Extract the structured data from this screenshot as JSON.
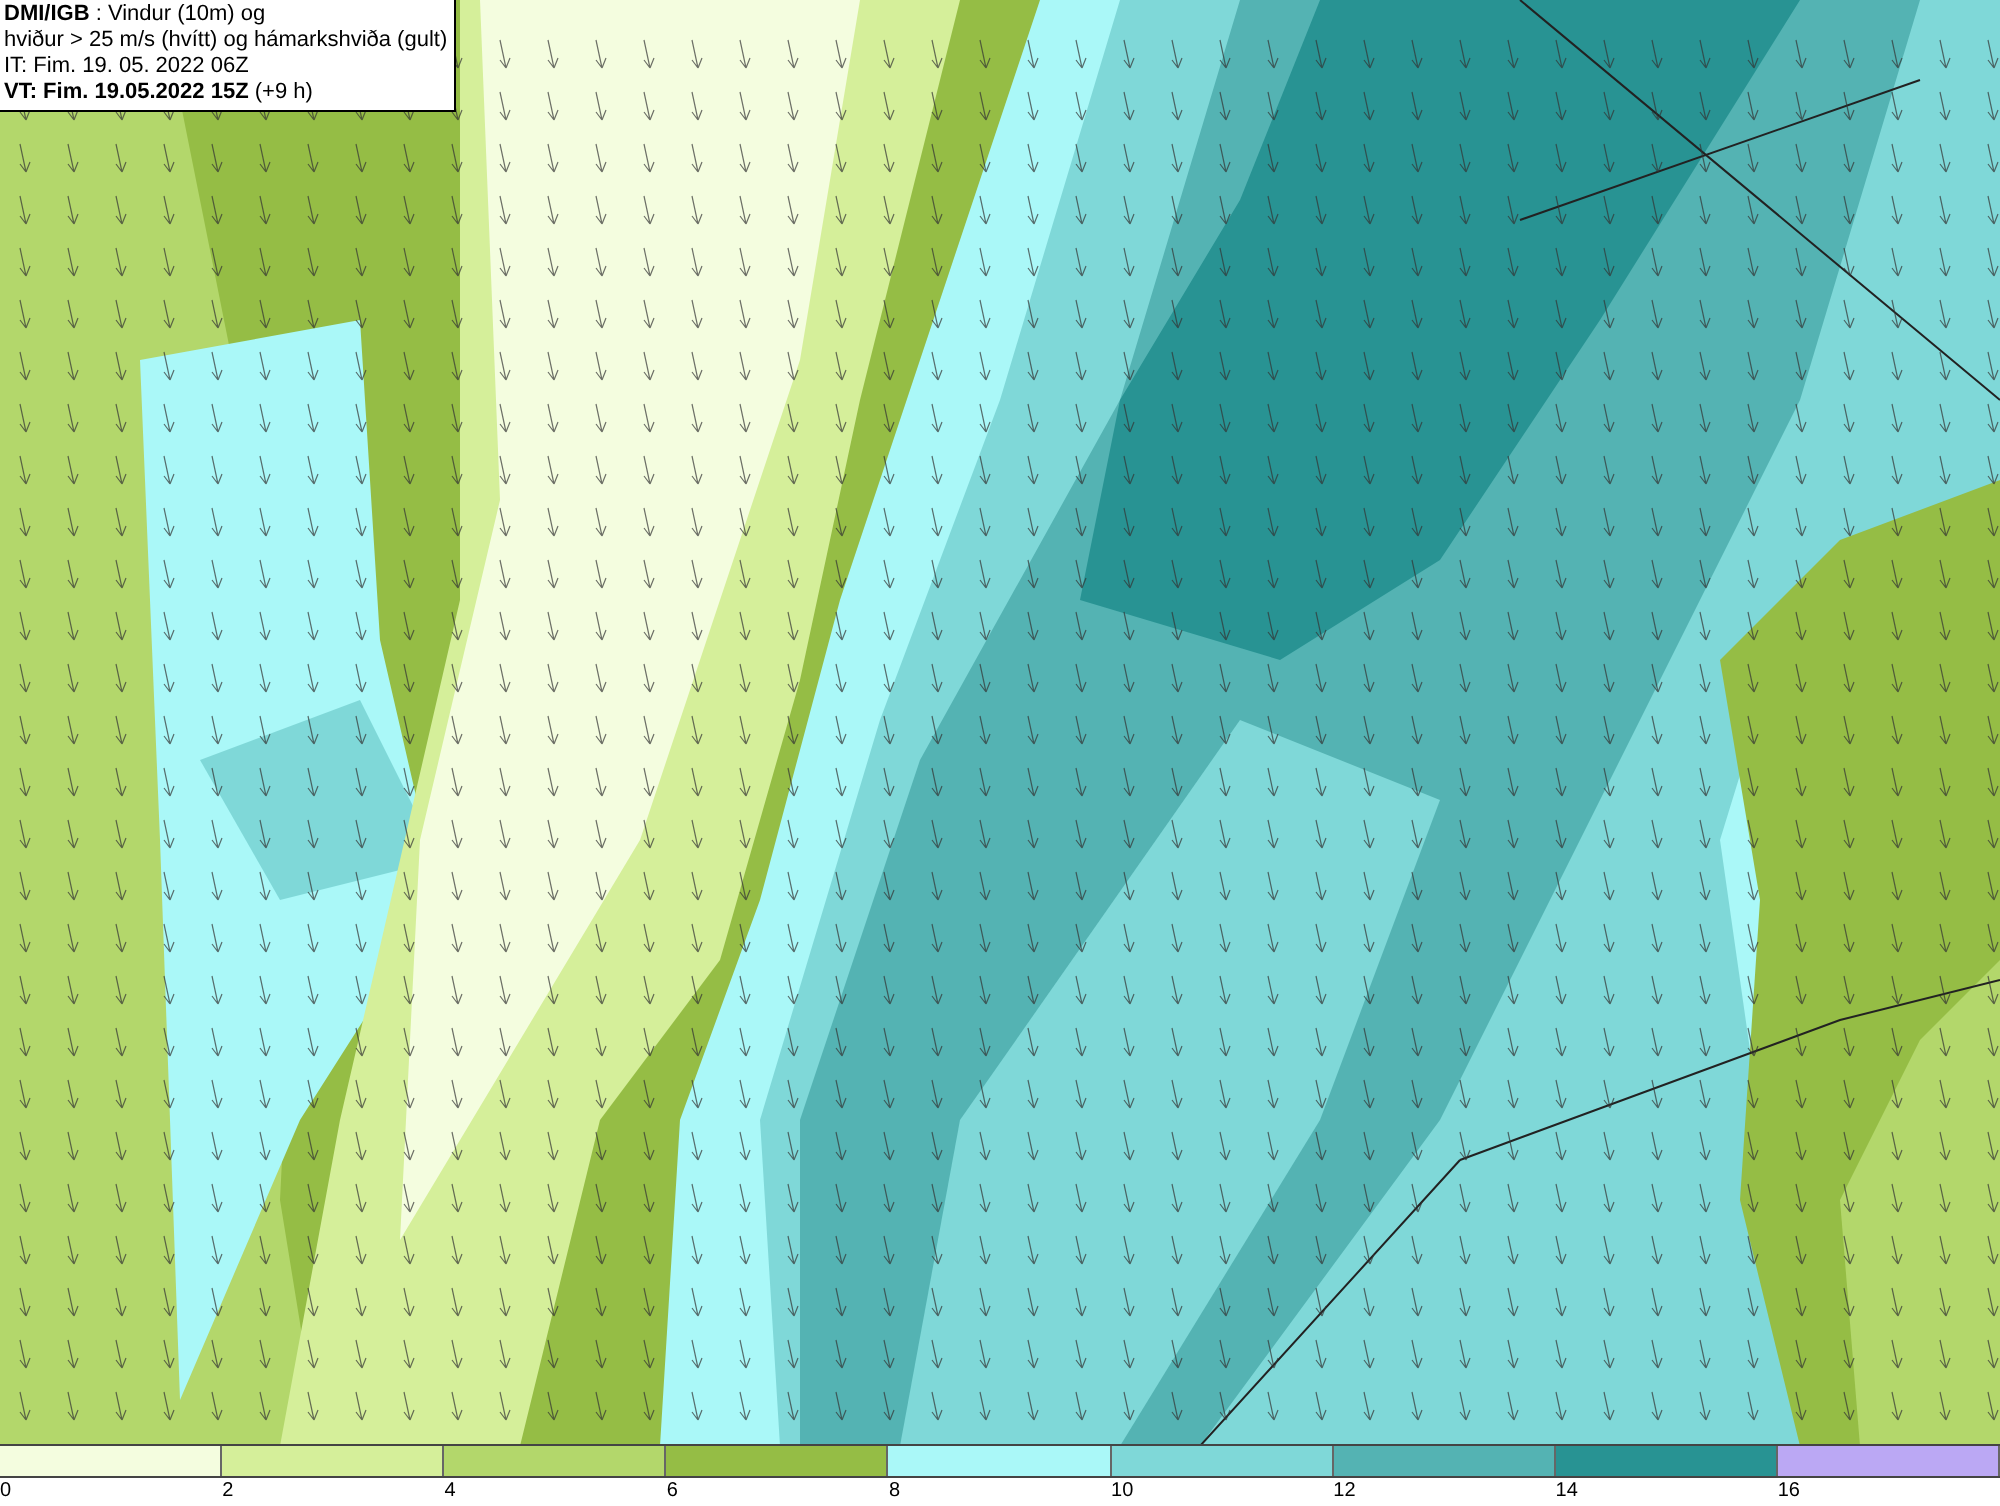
{
  "title_box": {
    "lines": [
      "**DMI/IGB** : Vindur (10m) og",
      "hviður > 25 m/s (hvítt) og hámarkshviða (gult)",
      "IT: Fim. 19. 05. 2022 06Z",
      "**VT: Fim. 19.05.2022 15Z** (+9 h)"
    ]
  },
  "legend": [
    {
      "label": "0",
      "color": "#f4fddf"
    },
    {
      "label": "2",
      "color": "#d5ef9a"
    },
    {
      "label": "4",
      "color": "#b3d76b"
    },
    {
      "label": "6",
      "color": "#95bd45"
    },
    {
      "label": "8",
      "color": "#aaf8f8"
    },
    {
      "label": "10",
      "color": "#7fd8d8"
    },
    {
      "label": "12",
      "color": "#54b3b3"
    },
    {
      "label": "14",
      "color": "#289393"
    },
    {
      "label": "16",
      "color": "#bba8f4"
    }
  ]
}
